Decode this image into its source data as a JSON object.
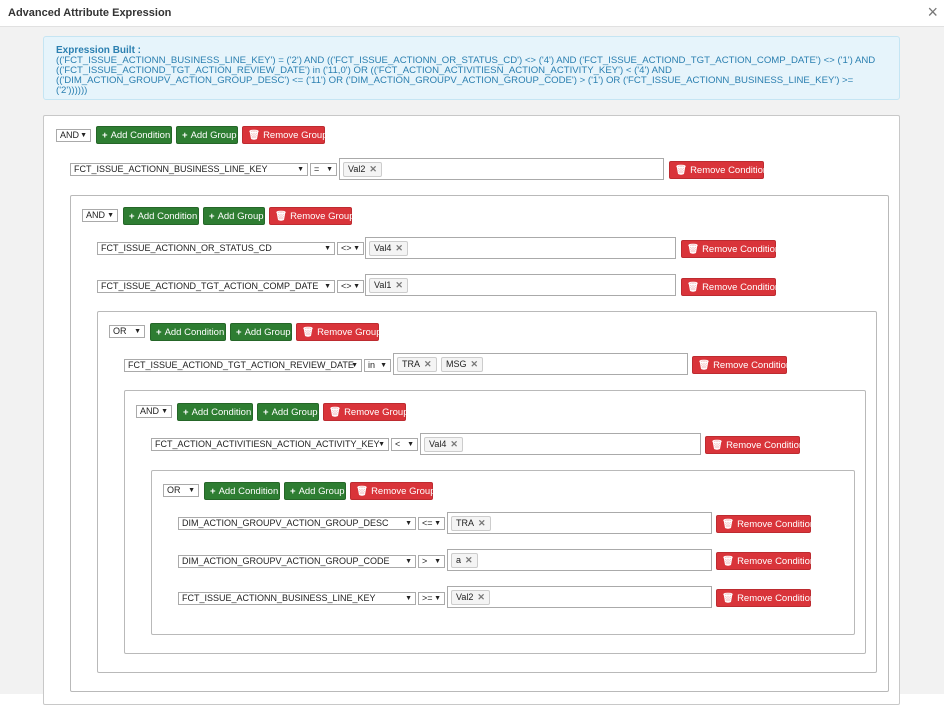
{
  "dialog": {
    "title": "Advanced Attribute Expression",
    "close_glyph": "×"
  },
  "expression": {
    "label": "Expression Built :",
    "text": "(('FCT_ISSUE_ACTIONN_BUSINESS_LINE_KEY') = ('2') AND (('FCT_ISSUE_ACTIONN_OR_STATUS_CD') <> ('4') AND ('FCT_ISSUE_ACTIOND_TGT_ACTION_COMP_DATE') <> ('1') AND (('FCT_ISSUE_ACTIOND_TGT_ACTION_REVIEW_DATE') in ('11,0') OR (('FCT_ACTION_ACTIVITIESN_ACTION_ACTIVITY_KEY') < ('4') AND (('DIM_ACTION_GROUPV_ACTION_GROUP_DESC') <= ('11') OR ('DIM_ACTION_GROUPV_ACTION_GROUP_CODE') > ('1') OR ('FCT_ISSUE_ACTIONN_BUSINESS_LINE_KEY') >= ('2'))))))"
  },
  "buttons": {
    "add_condition": "Add Condition",
    "add_group": "Add Group",
    "remove_group": "Remove Group",
    "remove_condition": "Remove Condition",
    "plus_glyph": "+",
    "trash_glyph": "🗑"
  },
  "groups": [
    {
      "op": "AND"
    },
    {
      "op": "AND"
    },
    {
      "op": "OR"
    },
    {
      "op": "AND"
    },
    {
      "op": "OR"
    }
  ],
  "conditions": [
    {
      "field": "FCT_ISSUE_ACTIONN_BUSINESS_LINE_KEY",
      "operator": "=",
      "values": [
        "Val2"
      ]
    },
    {
      "field": "FCT_ISSUE_ACTIONN_OR_STATUS_CD",
      "operator": "<>",
      "values": [
        "Val4"
      ]
    },
    {
      "field": "FCT_ISSUE_ACTIOND_TGT_ACTION_COMP_DATE",
      "operator": "<>",
      "values": [
        "Val1"
      ]
    },
    {
      "field": "FCT_ISSUE_ACTIOND_TGT_ACTION_REVIEW_DATE",
      "operator": "in",
      "values": [
        "TRA",
        "MSG"
      ]
    },
    {
      "field": "FCT_ACTION_ACTIVITIESN_ACTION_ACTIVITY_KEY",
      "operator": "<",
      "values": [
        "Val4"
      ]
    },
    {
      "field": "DIM_ACTION_GROUPV_ACTION_GROUP_DESC",
      "operator": "<=",
      "values": [
        "TRA"
      ]
    },
    {
      "field": "DIM_ACTION_GROUPV_ACTION_GROUP_CODE",
      "operator": ">",
      "values": [
        "a"
      ]
    },
    {
      "field": "FCT_ISSUE_ACTIONN_BUSINESS_LINE_KEY",
      "operator": ">=",
      "values": [
        "Val2"
      ]
    }
  ],
  "colors": {
    "add_button": "#2e7d32",
    "remove_button": "#d9343a",
    "expression_bg": "#e6f4fb",
    "expression_text": "#2a7fb0"
  }
}
